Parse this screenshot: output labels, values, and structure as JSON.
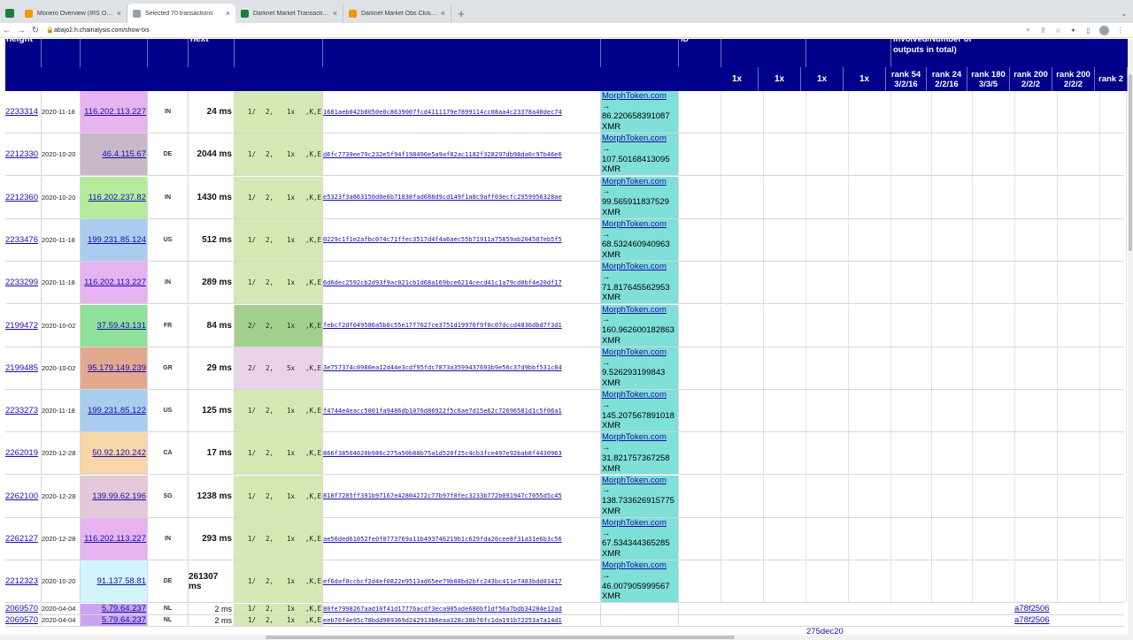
{
  "browser": {
    "tabs": [
      {
        "title": "Monero Overview (IRS Office...",
        "color": "#f29900"
      },
      {
        "title": "Selected 70 transactions",
        "color": "#9aa0a6",
        "active": true
      },
      {
        "title": "Darknet Market Transactions",
        "color": "#188038"
      },
      {
        "title": "Darknet Market Obs Clusters",
        "color": "#f29900"
      }
    ],
    "new_tab": "+",
    "url": "abajo2.h.chainalysis.com/show-txs"
  },
  "table": {
    "header_top": {
      "height": "height",
      "next": "next",
      "id": "ID",
      "involved": "involved/Number of outputs in total)"
    },
    "header_cols": [
      "1x",
      "1x",
      "1x",
      "1x",
      "rank 54 3/2/16",
      "rank 24 2/2/16",
      "rank 180 3/3/5",
      "rank 200 2/2/2",
      "rank 200 2/2/2",
      "rank 2"
    ],
    "rows": [
      {
        "height": "2233314",
        "date": "2020-11-18",
        "ip": "116.202.113.227",
        "ip_bg": "#e6b3f0",
        "cc": "IN",
        "lat": "24 ms",
        "pat": [
          "1/",
          "2,",
          "1x",
          ",K,E"
        ],
        "pat_bg": "#d5e8b4",
        "hash": "1681aeb042b8050e0c8639007fcd4111179e7899114cc08aa4c23378a40dec74",
        "ex_link": "MorphToken.com",
        "arrow": "→",
        "amount": "86.220658391087",
        "unit": "XMR"
      },
      {
        "height": "2212330",
        "date": "2020-10-20",
        "ip": "46.4.115.67",
        "ip_bg": "#c7b7c9",
        "cc": "DE",
        "lat": "2044 ms",
        "pat": [
          "1/",
          "2,",
          "1x",
          ",K,E"
        ],
        "pat_bg": "#d5e8b4",
        "hash": "d6fc7739ee79c232e5f94f198490e5a9af82ac1182f328297db98da0c97b46e6",
        "ex_link": "MorphToken.com",
        "arrow": "→",
        "amount": "107.50168413095",
        "unit": "XMR"
      },
      {
        "height": "2212360",
        "date": "2020-10-20",
        "ip": "116.202.237.82",
        "ip_bg": "#b6eb9c",
        "cc": "IN",
        "lat": "1430 ms",
        "pat": [
          "1/",
          "2,",
          "1x",
          ",K,E"
        ],
        "pat_bg": "#d5e8b4",
        "hash": "e5323f3a663150d0e6b71038fad688d9cd149f1a8c9aff03ecfc2959956328ae",
        "ex_link": "MorphToken.com",
        "arrow": "→",
        "amount": "99.565911837529",
        "unit": "XMR"
      },
      {
        "height": "2233476",
        "date": "2020-11-18",
        "ip": "199.231.85.124",
        "ip_bg": "#a9cdf0",
        "cc": "US",
        "lat": "512 ms",
        "pat": [
          "1/",
          "2,",
          "1x",
          ",K,E"
        ],
        "pat_bg": "#d5e8b4",
        "hash": "0229c1f1e2afbc074c71ffec3517d4f4a6aec55b71911a75859ab204507eb5f5",
        "ex_link": "MorphToken.com",
        "arrow": "→",
        "amount": "68.532460940963",
        "unit": "XMR"
      },
      {
        "height": "2233299",
        "date": "2020-11-18",
        "ip": "116.202.113.227",
        "ip_bg": "#e6b3f0",
        "cc": "IN",
        "lat": "289 ms",
        "pat": [
          "1/",
          "2,",
          "1x",
          ",K,E"
        ],
        "pat_bg": "#d5e8b4",
        "hash": "6d6dec2592cb2d93f9ac021cb1d68a169bce6214cecd41c1a79cd0bf4e20df17",
        "ex_link": "MorphToken.com",
        "arrow": "→",
        "amount": "71.817645562953",
        "unit": "XMR"
      },
      {
        "height": "2199472",
        "date": "2020-10-02",
        "ip": "37.59.43.131",
        "ip_bg": "#8ee09a",
        "cc": "FR",
        "lat": "84 ms",
        "pat": [
          "2/",
          "2,",
          "1x",
          ",K,E"
        ],
        "pat_bg": "#a3cf8e",
        "hash": "febcf2df049586a5b8c55e17f7627ce3751d19976f9f0c07dccd4836dbd7f3d1",
        "ex_link": "MorphToken.com",
        "arrow": "→",
        "amount": "160.962600182863",
        "unit": "XMR"
      },
      {
        "height": "2199485",
        "date": "2020-10-02",
        "ip": "95.179.149.239",
        "ip_bg": "#e3a98f",
        "cc": "GR",
        "lat": "29 ms",
        "pat": [
          "2/",
          "2,",
          "5x",
          ",K,E"
        ],
        "pat_bg": "#ead3ea",
        "hash": "3e757374c0980ea12d44e3cdf95fdc7873a3599437693b9e56c37d9bbf531c84",
        "ex_link": "MorphToken.com",
        "arrow": "→",
        "amount": "9.526293199843",
        "unit": "XMR"
      },
      {
        "height": "2233273",
        "date": "2020-11-18",
        "ip": "199.231.85.122",
        "ip_bg": "#a9cdf0",
        "cc": "US",
        "lat": "125 ms",
        "pat": [
          "1/",
          "2,",
          "1x",
          ",K,E"
        ],
        "pat_bg": "#d5e8b4",
        "hash": "f4744e4eacc5001fa9486db1076d86922f5c6ae7d15e62c72696581d1c5f06a1",
        "ex_link": "MorphToken.com",
        "arrow": "→",
        "amount": "145.207567891018",
        "unit": "XMR"
      },
      {
        "height": "2262019",
        "date": "2020-12-28",
        "ip": "50.92.120.242",
        "ip_bg": "#f7d6a8",
        "cc": "CA",
        "lat": "17 ms",
        "pat": [
          "1/",
          "2,",
          "1x",
          ",K,E"
        ],
        "pat_bg": "#d5e8b4",
        "hash": "866f38504020b986c275a50b88b75a1d520f25c4cb3fce497e92bab8f4430963",
        "ex_link": "MorphToken.com",
        "arrow": "→",
        "amount": "31.821757367258",
        "unit": "XMR"
      },
      {
        "height": "2262100",
        "date": "2020-12-28",
        "ip": "139.99.62.196",
        "ip_bg": "#e2c8d8",
        "cc": "SG",
        "lat": "1238 ms",
        "pat": [
          "1/",
          "2,",
          "1x",
          ",K,E"
        ],
        "pat_bg": "#d5e8b4",
        "hash": "818f7205ff391b97167e42804272c77b97f0fec3233b772b091947c7055d5c45",
        "ex_link": "MorphToken.com",
        "arrow": "→",
        "amount": "138.733626915775",
        "unit": "XMR"
      },
      {
        "height": "2262127",
        "date": "2020-12-28",
        "ip": "116.202.113.227",
        "ip_bg": "#e6b3f0",
        "cc": "IN",
        "lat": "293 ms",
        "pat": [
          "1/",
          "2,",
          "1x",
          ",K,E"
        ],
        "pat_bg": "#d5e8b4",
        "hash": "ae56ded61052fe0f0773769a11b493746219b1c629fda20cee8f31a31e6b3c56",
        "ex_link": "MorphToken.com",
        "arrow": "→",
        "amount": "67.534344365285",
        "unit": "XMR"
      },
      {
        "height": "2212323",
        "date": "2020-10-20",
        "ip": "91.137.58.81",
        "ip_bg": "#d2f4fb",
        "cc": "DE",
        "lat": "261307 ms",
        "pat": [
          "1/",
          "2,",
          "1x",
          ",K,E"
        ],
        "pat_bg": "#d5e8b4",
        "hash": "ef6daf0ccbcf2d4ef0822e9513ad65ee79b08bd2bfc243bc411e7483bdd03417",
        "ex_link": "MorphToken.com",
        "arrow": "→",
        "amount": "46.007905999567",
        "unit": "XMR"
      }
    ],
    "short_rows": [
      {
        "height": "2069570",
        "date": "2020-04-04",
        "ip": "5.79.64.237",
        "cc": "NL",
        "lat": "2 ms",
        "pat": [
          "1/",
          "2,",
          "1x",
          ",K,E"
        ],
        "hash": "80fe7998267aad10f41d17776acdf3eca905ade680bf1df56a7bdb34284e12ad",
        "right_link": "a78f2506"
      },
      {
        "height": "2069570",
        "date": "2020-04-04",
        "ip": "5.79.64.237",
        "cc": "NL",
        "lat": "2 ms",
        "pat": [
          "1/",
          "2,",
          "1x",
          ",K,E"
        ],
        "hash": "eeb76f4e95c78bdd989369d242913b6eaa328c38b76fc1da191b72253a7a14d1",
        "right_link": "a78f2506"
      }
    ],
    "bottom_partial": "275dec20"
  }
}
